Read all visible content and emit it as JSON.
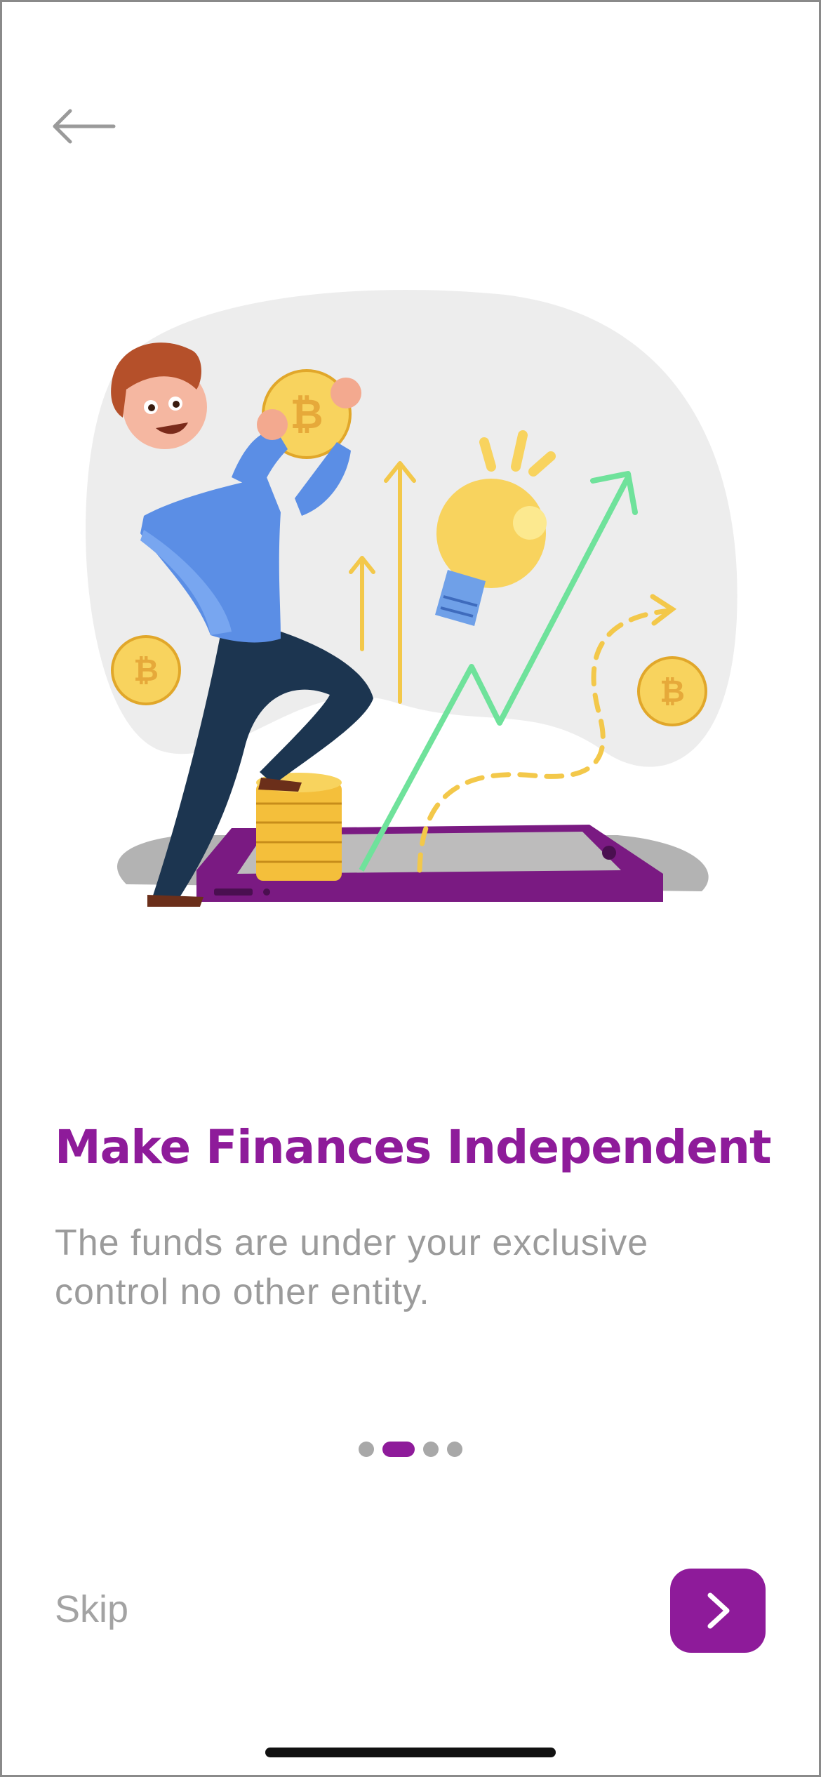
{
  "header": {
    "back_icon": "arrow-left-icon"
  },
  "illustration": {
    "description_icon": "finance-growth-illustration"
  },
  "content": {
    "title": "Make Finances Independent",
    "subtitle": "The funds are under your exclusive control no other entity."
  },
  "pager": {
    "count": 4,
    "active_index": 1
  },
  "footer": {
    "skip_label": "Skip",
    "next_icon": "chevron-right-icon"
  },
  "colors": {
    "brand": "#8e1b9a",
    "title": "#8e1b9a",
    "subtitle": "#9b9b9b",
    "skip": "#a3a3a3",
    "dot_inactive": "#a8a8a8",
    "back_icon": "#9a9a9a"
  }
}
